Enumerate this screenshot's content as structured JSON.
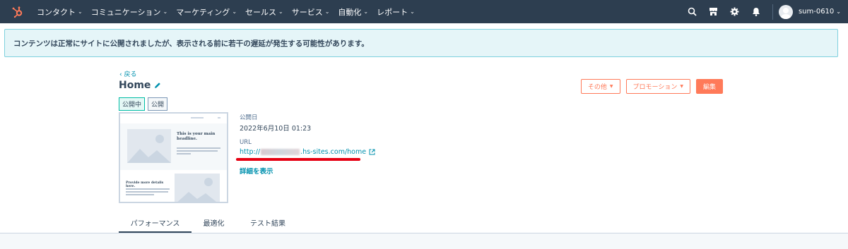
{
  "nav": {
    "items": [
      {
        "label": "コンタクト"
      },
      {
        "label": "コミュニケーション"
      },
      {
        "label": "マーケティング"
      },
      {
        "label": "セールス"
      },
      {
        "label": "サービス"
      },
      {
        "label": "自動化"
      },
      {
        "label": "レポート"
      }
    ],
    "account_name": "sum-0610",
    "icons": [
      "hubspot-logo",
      "search-icon",
      "marketplace-icon",
      "settings-icon",
      "notifications-icon",
      "avatar"
    ]
  },
  "alert": {
    "message": "コンテンツは正常にサイトに公開されましたが、表示される前に若干の遅延が発生する可能性があります。"
  },
  "page": {
    "back_label": "戻る",
    "title": "Home",
    "tags": [
      "公開中",
      "公開"
    ],
    "buttons": {
      "more": "その他",
      "promotion": "プロモーション",
      "edit": "編集"
    },
    "published_label": "公開日",
    "published_value": "2022年6月10日 01:23",
    "url_label": "URL",
    "url_prefix": "http://",
    "url_suffix": ".hs-sites.com/home",
    "details_link": "詳細を表示",
    "thumbnail": {
      "headline": "This is your main headline.",
      "subheadline": "Provide more details here."
    }
  },
  "tabs": [
    {
      "label": "パフォーマンス",
      "active": true
    },
    {
      "label": "最適化",
      "active": false
    },
    {
      "label": "テスト結果",
      "active": false
    }
  ],
  "colors": {
    "nav_bg": "#2d3e50",
    "accent": "#ff7a59",
    "link": "#0091ae",
    "alert_bg": "#e5f5f8",
    "alert_border": "#7fd1de",
    "annotation_red": "#e60012"
  }
}
